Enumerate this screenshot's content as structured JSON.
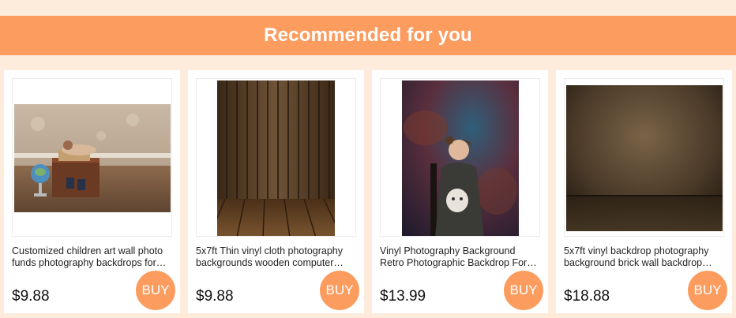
{
  "header": {
    "title": "Recommended for you"
  },
  "products": [
    {
      "title": "Customized children art wall photo funds photography backdrops for newborn",
      "price": "$9.88",
      "buy_label": "BUY"
    },
    {
      "title": "5x7ft Thin vinyl cloth photography backgrounds wooden computer printed",
      "price": "$9.88",
      "buy_label": "BUY"
    },
    {
      "title": "Vinyl Photography Background Retro Photographic Backdrop For Photo Studio",
      "price": "$13.99",
      "buy_label": "BUY"
    },
    {
      "title": "5x7ft vinyl backdrop photography background brick wall backdrop studio",
      "price": "$18.88",
      "buy_label": "BUY"
    }
  ],
  "colors": {
    "accent": "#fd9c5f",
    "page_bg": "#fdebdc"
  }
}
